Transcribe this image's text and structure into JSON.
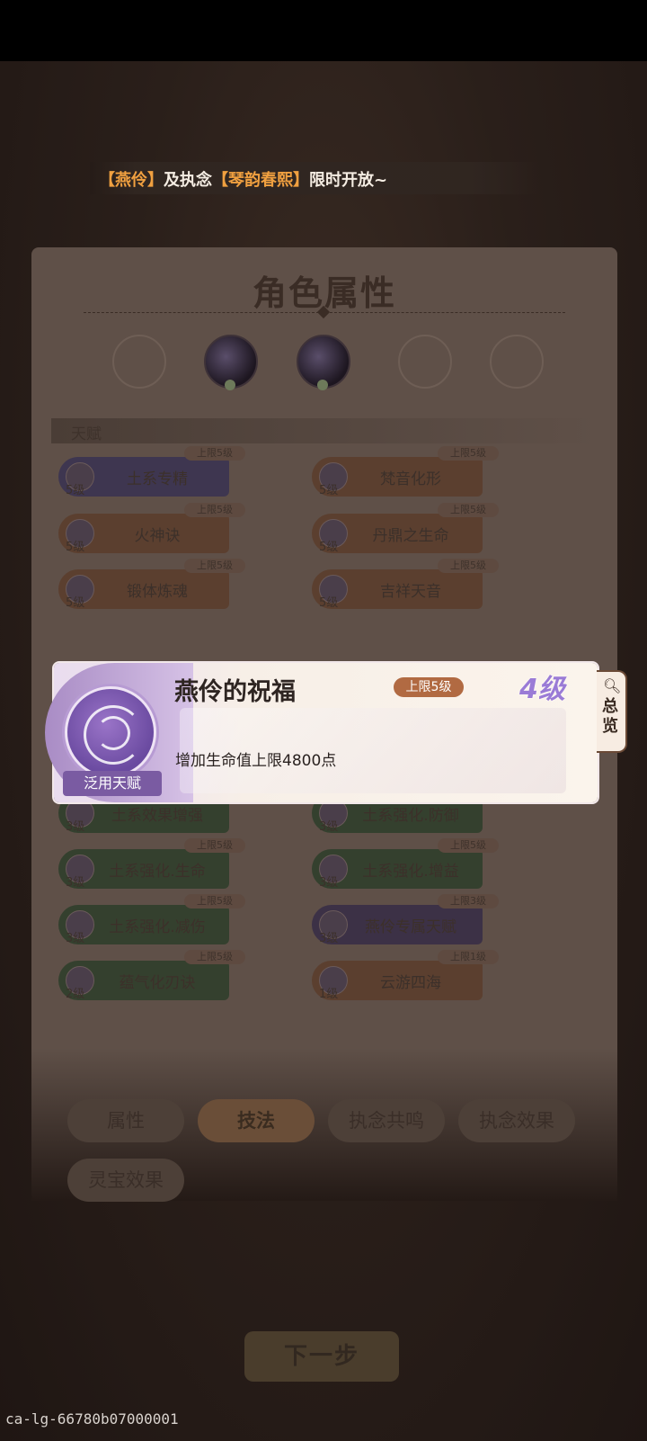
{
  "banner": {
    "part1": "【燕伶】",
    "part2": "及执念",
    "part3": "【琴韵春熙】",
    "part4": "限时开放~"
  },
  "panel": {
    "title": "角色属性",
    "section_label": "天赋"
  },
  "talents": [
    {
      "name": "土系专精",
      "level": "5级",
      "cap": "上限5级",
      "color": "blue"
    },
    {
      "name": "梵音化形",
      "level": "5级",
      "cap": "上限5级",
      "color": "brown"
    },
    {
      "name": "火神诀",
      "level": "5级",
      "cap": "上限5级",
      "color": "brown"
    },
    {
      "name": "丹鼎之生命",
      "level": "5级",
      "cap": "上限5级",
      "color": "brown"
    },
    {
      "name": "锻体炼魂",
      "level": "5级",
      "cap": "上限5级",
      "color": "brown"
    },
    {
      "name": "吉祥天音",
      "level": "5级",
      "cap": "上限5级",
      "color": "brown"
    },
    {
      "name": "土系效果增强",
      "level": "3级",
      "cap": "",
      "color": "green"
    },
    {
      "name": "土系强化.防御",
      "level": "3级",
      "cap": "",
      "color": "green"
    },
    {
      "name": "土系强化.生命",
      "level": "3级",
      "cap": "上限5级",
      "color": "green"
    },
    {
      "name": "土系强化.增益",
      "level": "3级",
      "cap": "上限5级",
      "color": "green"
    },
    {
      "name": "土系强化.减伤",
      "level": "3级",
      "cap": "上限5级",
      "color": "green"
    },
    {
      "name": "燕伶专属天赋",
      "level": "3级",
      "cap": "上限3级",
      "color": "purple"
    },
    {
      "name": "蕴气化刃诀",
      "level": "2级",
      "cap": "上限5级",
      "color": "green"
    },
    {
      "name": "云游四海",
      "level": "1级",
      "cap": "上限1级",
      "color": "brown"
    }
  ],
  "tabs": [
    "属性",
    "技法",
    "执念共鸣",
    "执念效果",
    "灵宝效果"
  ],
  "active_tab": "技法",
  "popup": {
    "title": "燕伶的祝福",
    "cap": "上限5级",
    "level": "4级",
    "description": "增加生命值上限4800点",
    "ribbon": "泛用天赋"
  },
  "overview": {
    "label": "总览",
    "icon": "search-icon"
  },
  "next_button": "下一步",
  "footer_id": "ca-lg-66780b07000001",
  "colors": {
    "accent": "#9a7bd6",
    "cap_badge": "#b16a42",
    "banner_highlight": "#f0a040"
  }
}
